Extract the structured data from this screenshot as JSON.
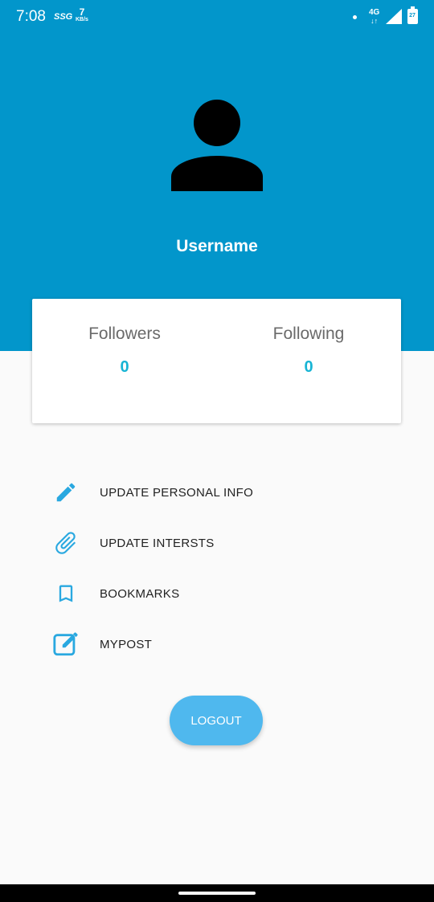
{
  "status_bar": {
    "time": "7:08",
    "carrier_icon": "SSG",
    "speed_value": "7",
    "speed_unit": "KB/s",
    "network": "4G",
    "network_arrows": "↓↑",
    "battery": "27"
  },
  "profile": {
    "username": "Username",
    "avatar_icon": "person-icon"
  },
  "stats": {
    "followers_label": "Followers",
    "followers_value": "0",
    "following_label": "Following",
    "following_value": "0"
  },
  "menu": {
    "items": [
      {
        "label": "UPDATE PERSONAL INFO",
        "icon": "pencil-icon"
      },
      {
        "label": "UPDATE INTERSTS",
        "icon": "paperclip-icon"
      },
      {
        "label": "BOOKMARKS",
        "icon": "bookmark-icon"
      },
      {
        "label": "MYPOST",
        "icon": "edit-square-icon"
      }
    ]
  },
  "logout_label": "LOGOUT",
  "colors": {
    "header": "#0296cb",
    "accent": "#17b4d4",
    "icon": "#29a8e0",
    "logout": "#4fb8ee"
  }
}
